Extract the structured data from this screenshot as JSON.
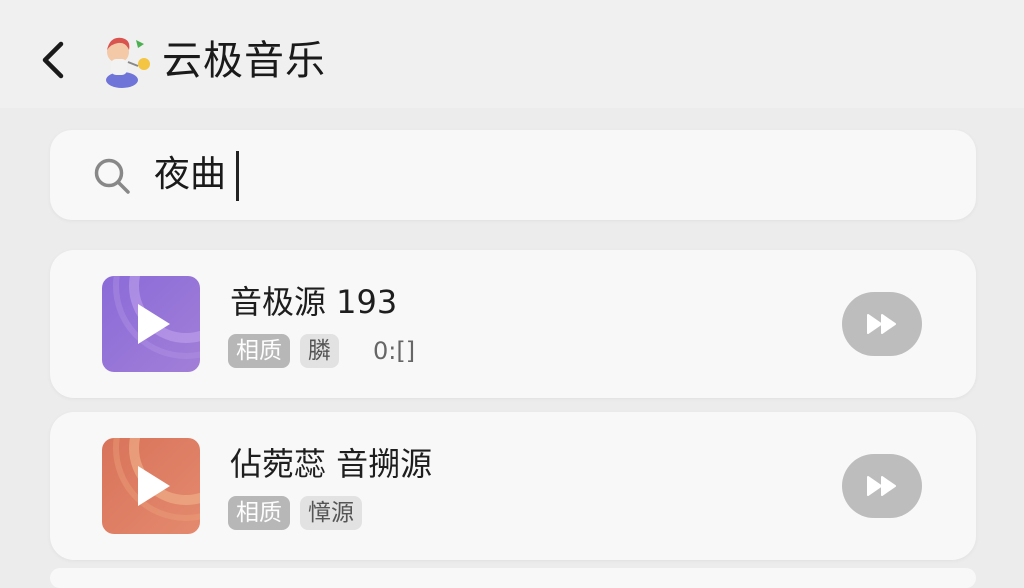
{
  "header": {
    "back_icon": "chevron-left-icon",
    "logo_icon": "app-logo-icon",
    "title": "云极音乐"
  },
  "search": {
    "icon": "search-icon",
    "value": "夜曲"
  },
  "results": [
    {
      "title": "音极源 193",
      "thumb_colors": [
        "#8b6bd8",
        "#b48cd6"
      ],
      "tags": [
        "相质",
        "膦"
      ],
      "duration": "0:[]",
      "action_icon": "fast-forward-icon"
    },
    {
      "title": "佔菀蕊 音搠源",
      "thumb_colors": [
        "#d8735a",
        "#eaa07a"
      ],
      "tags": [
        "相质",
        "慞源"
      ],
      "action_icon": "fast-forward-icon"
    }
  ],
  "colors": {
    "background": "#ececec",
    "card": "#f8f8f8",
    "tag_dark": "#b7b7b7",
    "button": "#bdbdbd"
  }
}
